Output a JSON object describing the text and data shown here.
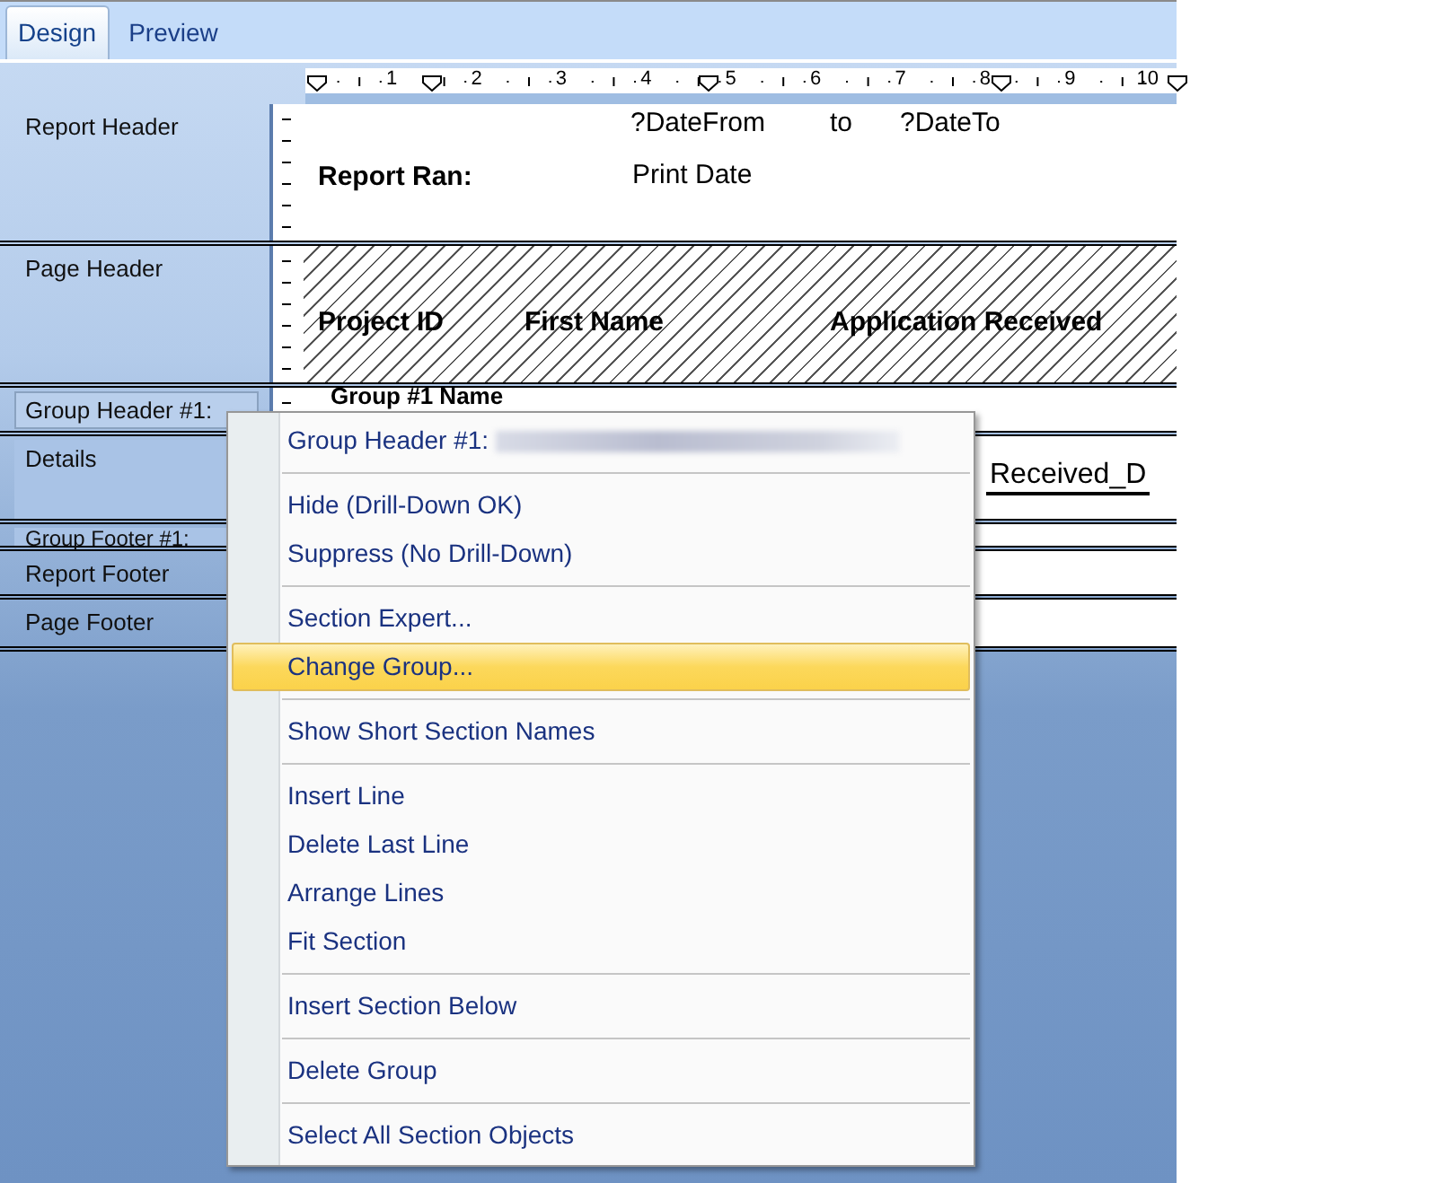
{
  "tabs": [
    {
      "label": "Design",
      "selected": true
    },
    {
      "label": "Preview",
      "selected": false
    }
  ],
  "ruler": {
    "labels": [
      "1",
      "2",
      "3",
      "4",
      "5",
      "6",
      "7",
      "8",
      "9",
      "10"
    ]
  },
  "sections": [
    {
      "name": "Report Header",
      "selected": false,
      "in_group": false,
      "fields": [
        {
          "text": "?DateFrom",
          "bold": false
        },
        {
          "text": "to",
          "bold": false
        },
        {
          "text": "?DateTo",
          "bold": false
        },
        {
          "text": "Report Ran:",
          "bold": true
        },
        {
          "text": "Print Date",
          "bold": false
        }
      ]
    },
    {
      "name": "Page Header",
      "selected": false,
      "in_group": false,
      "hatched": true,
      "fields": [
        {
          "text": "Project ID",
          "bold": true
        },
        {
          "text": "First Name",
          "bold": true
        },
        {
          "text": "Application Received",
          "bold": true
        }
      ]
    },
    {
      "name": "Group Header #1:",
      "selected": true,
      "in_group": true,
      "fields": [
        {
          "text": "Group #1 Name",
          "bold": true
        }
      ]
    },
    {
      "name": "Details",
      "selected": false,
      "in_group": true,
      "fields": [
        {
          "text": "Received_D",
          "bold": false
        }
      ]
    },
    {
      "name": "Group Footer #1:",
      "selected": false,
      "in_group": true
    },
    {
      "name": "Report Footer",
      "selected": false,
      "in_group": false
    },
    {
      "name": "Page Footer",
      "selected": false,
      "in_group": false
    }
  ],
  "context_menu": {
    "items": [
      {
        "kind": "header",
        "label": "Group Header #1:",
        "selected": false
      },
      {
        "kind": "separator"
      },
      {
        "kind": "item",
        "label": "Hide (Drill-Down OK)",
        "selected": false
      },
      {
        "kind": "item",
        "label": "Suppress (No Drill-Down)",
        "selected": false
      },
      {
        "kind": "separator"
      },
      {
        "kind": "item",
        "label": "Section Expert...",
        "selected": false
      },
      {
        "kind": "item",
        "label": "Change Group...",
        "selected": true
      },
      {
        "kind": "separator"
      },
      {
        "kind": "item",
        "label": "Show Short Section Names",
        "selected": false
      },
      {
        "kind": "separator"
      },
      {
        "kind": "item",
        "label": "Insert Line",
        "selected": false
      },
      {
        "kind": "item",
        "label": "Delete Last Line",
        "selected": false
      },
      {
        "kind": "item",
        "label": "Arrange Lines",
        "selected": false
      },
      {
        "kind": "item",
        "label": "Fit Section",
        "selected": false
      },
      {
        "kind": "separator"
      },
      {
        "kind": "item",
        "label": "Insert Section Below",
        "selected": false
      },
      {
        "kind": "separator"
      },
      {
        "kind": "item",
        "label": "Delete Group",
        "selected": false
      },
      {
        "kind": "separator"
      },
      {
        "kind": "item",
        "label": "Select All Section Objects",
        "selected": false
      }
    ]
  }
}
